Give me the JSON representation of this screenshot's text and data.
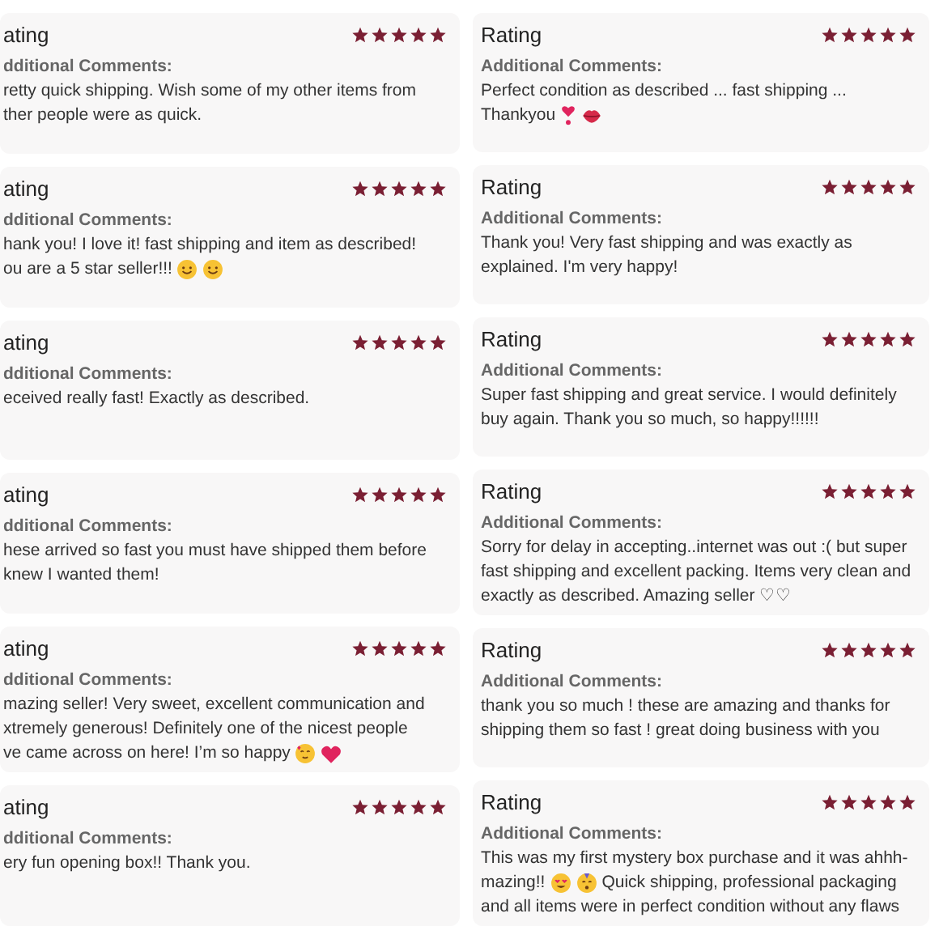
{
  "columns": [
    {
      "reviews": [
        {
          "title": "ating",
          "stars": 5,
          "label": "dditional Comments:",
          "lines": [
            {
              "text": "retty quick shipping. Wish some of my other items from"
            },
            {
              "text": "ther people were as quick."
            }
          ]
        },
        {
          "title": "ating",
          "stars": 5,
          "label": "dditional Comments:",
          "lines": [
            {
              "text": "hank you! I love it! fast shipping and item as described!"
            },
            {
              "text": "ou are a 5 star seller!!!",
              "icons": [
                {
                  "kind": "smile"
                },
                {
                  "kind": "smile"
                }
              ]
            }
          ]
        },
        {
          "title": "ating",
          "stars": 5,
          "label": "dditional Comments:",
          "lines": [
            {
              "text": "eceived really fast! Exactly as described."
            }
          ]
        },
        {
          "title": "ating",
          "stars": 5,
          "label": "dditional Comments:",
          "lines": [
            {
              "text": "hese arrived so fast you must have shipped them before"
            },
            {
              "text": "knew I wanted them!"
            }
          ]
        },
        {
          "title": "ating",
          "stars": 5,
          "label": "dditional Comments:",
          "lines": [
            {
              "text": "mazing seller! Very sweet, excellent communication and"
            },
            {
              "text": "xtremely generous! Definitely one of the nicest people"
            },
            {
              "text": "ve came across on here! I’m so happy",
              "icons": [
                {
                  "kind": "hearts-face"
                },
                {
                  "kind": "heart"
                }
              ]
            }
          ]
        },
        {
          "title": "ating",
          "stars": 5,
          "label": "dditional Comments:",
          "lines": [
            {
              "text": "ery fun opening box!! Thank you."
            }
          ]
        }
      ]
    },
    {
      "reviews": [
        {
          "title": "Rating",
          "stars": 5,
          "label": "Additional Comments:",
          "lines": [
            {
              "text": "Perfect condition as described ... fast shipping ..."
            },
            {
              "text": "Thankyou",
              "icons": [
                {
                  "kind": "heart-exclamation"
                },
                {
                  "kind": "lips"
                }
              ]
            }
          ]
        },
        {
          "title": "Rating",
          "stars": 5,
          "label": "Additional Comments:",
          "lines": [
            {
              "text": "Thank you! Very fast shipping and was exactly as"
            },
            {
              "text": "explained. I'm very happy!"
            }
          ]
        },
        {
          "title": "Rating",
          "stars": 5,
          "label": "Additional Comments:",
          "lines": [
            {
              "text": "Super fast shipping and great service. I would definitely"
            },
            {
              "text": "buy again. Thank you so much, so happy!!!!!!"
            }
          ]
        },
        {
          "title": "Rating",
          "stars": 5,
          "label": "Additional Comments:",
          "lines": [
            {
              "text": "Sorry for delay in accepting..internet was out :( but super"
            },
            {
              "text": "fast shipping and excellent packing. Items very clean and"
            },
            {
              "text": "exactly as described. Amazing seller ♡♡"
            }
          ]
        },
        {
          "title": "Rating",
          "stars": 5,
          "label": "Additional Comments:",
          "lines": [
            {
              "text": "thank you so much ! these are amazing and thanks for"
            },
            {
              "text": "shipping them so fast ! great doing business with you"
            }
          ]
        },
        {
          "title": "Rating",
          "stars": 5,
          "label": "Additional Comments:",
          "lines": [
            {
              "text": "This was my first mystery box purchase and it was ahhh-"
            },
            {
              "text": "mazing!!",
              "icons": [
                {
                  "kind": "heart-eyes"
                },
                {
                  "kind": "party-face"
                }
              ],
              "after": "Quick shipping, professional packaging"
            },
            {
              "text": "and all items were in perfect condition without any flaws"
            }
          ]
        }
      ]
    }
  ]
}
